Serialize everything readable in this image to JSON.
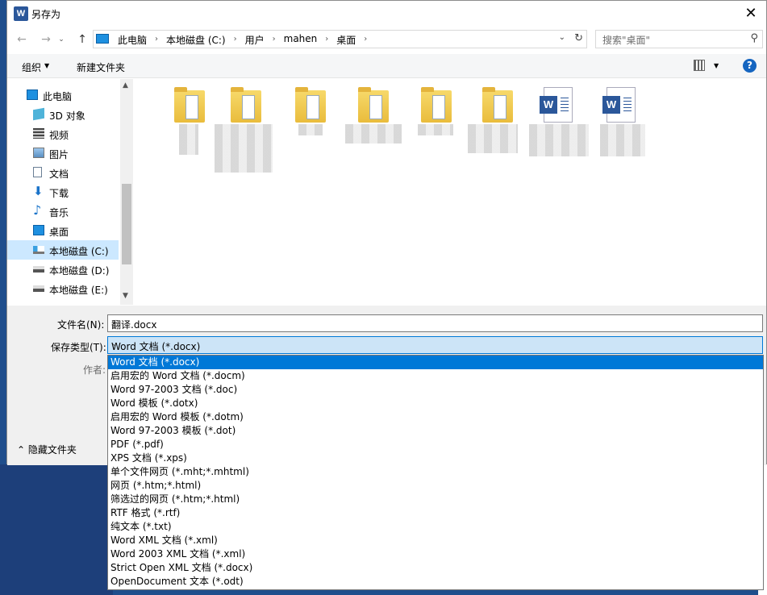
{
  "window": {
    "title": "另存为",
    "close_symbol": "✕",
    "app_icon_letter": "W"
  },
  "nav": {
    "back": "←",
    "forward": "→",
    "up": "↑",
    "history": "⌄"
  },
  "address": {
    "crumbs": [
      "此电脑",
      "本地磁盘 (C:)",
      "用户",
      "mahen",
      "桌面"
    ],
    "separator": "›",
    "dropdown": "⌄",
    "refresh": "↻"
  },
  "search": {
    "placeholder": "搜索\"桌面\"",
    "icon": "⚲"
  },
  "toolbar": {
    "organize": "组织",
    "organize_arrow": "▼",
    "new_folder": "新建文件夹",
    "view_arrow": "▼",
    "help": "?"
  },
  "sidebar": {
    "items": [
      {
        "label": "此电脑",
        "icon": "pc-icon",
        "color": "#1e90e0"
      },
      {
        "label": "3D 对象",
        "icon": "cube-icon",
        "color": "#4fb3d9"
      },
      {
        "label": "视频",
        "icon": "video-icon",
        "color": "#444444"
      },
      {
        "label": "图片",
        "icon": "picture-icon",
        "color": "#5a8fc1"
      },
      {
        "label": "文档",
        "icon": "document-icon",
        "color": "#6a7f95"
      },
      {
        "label": "下载",
        "icon": "download-icon",
        "color": "#1a73c9"
      },
      {
        "label": "音乐",
        "icon": "music-icon",
        "color": "#1a73c9"
      },
      {
        "label": "桌面",
        "icon": "desktop-icon",
        "color": "#1e90e0"
      },
      {
        "label": "本地磁盘 (C:)",
        "icon": "drive-c-icon",
        "color": "#555555",
        "selected": true
      },
      {
        "label": "本地磁盘 (D:)",
        "icon": "drive-icon",
        "color": "#555555"
      },
      {
        "label": "本地磁盘 (E:)",
        "icon": "drive-icon",
        "color": "#555555"
      }
    ],
    "scroll_up": "▲",
    "scroll_down": "▼"
  },
  "files": [
    {
      "type": "folder"
    },
    {
      "type": "folder"
    },
    {
      "type": "folder"
    },
    {
      "type": "folder"
    },
    {
      "type": "folder"
    },
    {
      "type": "folder"
    },
    {
      "type": "word",
      "letter": "W"
    },
    {
      "type": "word",
      "letter": "W"
    }
  ],
  "form": {
    "filename_label": "文件名(N):",
    "filename_value": "翻译.docx",
    "filetype_label": "保存类型(T):",
    "filetype_value": "Word 文档 (*.docx)",
    "author_label": "作者:",
    "combo_arrow": "⌄",
    "hide_folders": "⌃ 隐藏文件夹"
  },
  "filetype_options": [
    "Word 文档 (*.docx)",
    "启用宏的 Word 文档 (*.docm)",
    "Word 97-2003 文档 (*.doc)",
    "Word 模板 (*.dotx)",
    "启用宏的 Word 模板 (*.dotm)",
    "Word 97-2003 模板 (*.dot)",
    "PDF (*.pdf)",
    "XPS 文档 (*.xps)",
    "单个文件网页 (*.mht;*.mhtml)",
    "网页 (*.htm;*.html)",
    "筛选过的网页 (*.htm;*.html)",
    "RTF 格式 (*.rtf)",
    "纯文本 (*.txt)",
    "Word XML 文档 (*.xml)",
    "Word 2003 XML 文档 (*.xml)",
    "Strict Open XML 文档 (*.docx)",
    "OpenDocument 文本 (*.odt)"
  ]
}
